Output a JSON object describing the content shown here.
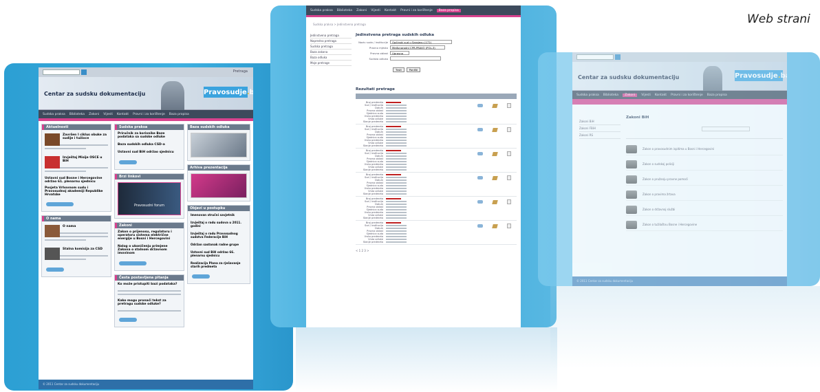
{
  "caption": "Web strani",
  "site": {
    "title": "Centar za sudsku dokumentaciju",
    "brand_main": "Pravosudje",
    "brand_suffix": "ba",
    "search_label": "Pretraga",
    "nav": [
      "Sudska praksa",
      "Biblioteka",
      "Zakoni",
      "Vijesti",
      "Kontakt",
      "Pravni i za korištenje",
      "Baza propisa"
    ]
  },
  "left_page": {
    "sections": {
      "news_title": "Aktuelnosti",
      "practice_title": "Sudska praksa",
      "base_title": "Baza sudskih odluka",
      "forum_title": "Brzi linkovi",
      "info_title": "O nama",
      "laws_title": "Zakoni",
      "events_title": "Objavi u postupku",
      "faq_title": "Česta postavljena pitanja",
      "video_title": "Arhiva prezentacija"
    },
    "news": [
      {
        "title": "Završen I ciklus obuke za sudije i tužioce"
      },
      {
        "title": "Izvještaj Misije OSCE u BiH"
      },
      {
        "title": "Ustavni sud Bosne i Hercegovine održao 61. plenarnu sjednicu"
      },
      {
        "title": "Posjeta Vrhovnom sudu i Pravosudnoj akademiji Republike Hrvatske"
      }
    ],
    "practice": [
      {
        "title": "Priručnik za korisnike Baze podataka sa sudske odluke"
      },
      {
        "title": "Baza sudskih odluka CSD-a"
      },
      {
        "title": "Ustavni sud BiH održao sjednicu"
      }
    ],
    "forum_label": "Pravosudni forum",
    "about": [
      {
        "title": "O nama"
      },
      {
        "title": "Stalna komisija za CSD"
      }
    ],
    "laws": [
      {
        "title": "Zakon o prijenosu, regulatoru i operatoru sistema električne energije u Bosni i Hercegovini"
      },
      {
        "title": "Nalog o ukoničenju primjene Zakona o stalnom državnom imovinom"
      }
    ],
    "faq": [
      {
        "title": "Ko može pristupiti bazi podataka?"
      },
      {
        "title": "Kako mogu pronaći tekst za pretragu sudske odluke?"
      }
    ],
    "events": [
      {
        "title": "Imenovan stručni savjetnik"
      },
      {
        "title": "Izvještaj o radu sudova u 2011. godini"
      },
      {
        "title": "Izvještaj o radu Pravosudnog sudstva Federacije BiH"
      },
      {
        "title": "Održan sastanak radne grupe"
      },
      {
        "title": "Ustavni sud BiH održao 66. plenarnu sjednicu"
      },
      {
        "title": "Realizacija Plana za rješavanje starih predmeta"
      }
    ],
    "footer": "© 2011 Centar za sudsku dokumentaciju"
  },
  "middle_page": {
    "breadcrumb": "Sudska praksa > Jedinstvena pretraga",
    "sidebar": [
      "Jedinstvena pretraga",
      "Napredna pretraga",
      "Sudska pretraga",
      "Baza zakona",
      "Baza odluka",
      "Moje pretrage"
    ],
    "form_title": "Jedinstvena pretraga sudskih odluka",
    "fields": [
      {
        "label": "Naziv suda / institucije",
        "value": "Općinski sud u Sarajevu (172)"
      },
      {
        "label": "Pravno mjesto",
        "value": "Međunarodni CPR-PRAVO (POL-3)"
      },
      {
        "label": "Pravna oblast",
        "value": "Upravno"
      },
      {
        "label": "Sudska odluka",
        "value": ""
      }
    ],
    "search_button": "Traži",
    "reset_button": "Poništi",
    "results_title": "Rezultati pretrage",
    "result_fields": [
      "Broj predmeta",
      "Sud / institucija",
      "Datum",
      "Pravna oblast",
      "Sjednica suda",
      "Vrsta predmeta",
      "Vrsta odluke",
      "Stanje predmeta"
    ],
    "result_count": 6,
    "pager": "< 1 2 3 >"
  },
  "right_page": {
    "section_title": "Zakoni BiH",
    "sidebar": [
      "Zakoni BiH",
      "Zakoni FBiH",
      "Zakoni RS"
    ],
    "items": [
      {
        "title": "Zakon o pravosudnim ispitima u Bosni i Hercegovini"
      },
      {
        "title": "Zakon o sudskoj policiji"
      },
      {
        "title": "Zakon o pružanju pravne pomoći"
      },
      {
        "title": "Zakon o pravima žrtava"
      },
      {
        "title": "Zakon o državnoj službi"
      },
      {
        "title": "Zakon o tužilaštvu Bosne i Hercegovine"
      }
    ],
    "footer": "© 2011 Centar za sudsku dokumentaciju"
  },
  "colors": {
    "accent": "#d8428e",
    "brand": "#3aa3de",
    "nav": "#3d4a5c",
    "frame": "#2c9fd3"
  }
}
